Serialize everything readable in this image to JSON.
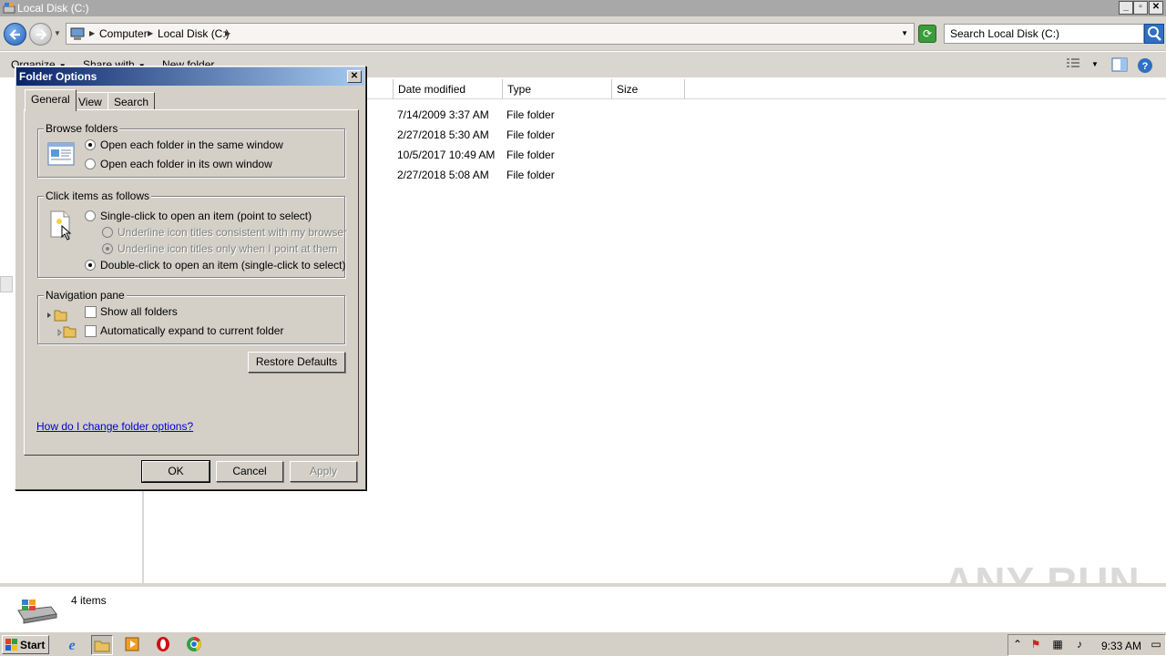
{
  "window": {
    "title": "Local Disk (C:)",
    "buttons": {
      "minimize": "_",
      "maximize": "▫",
      "close": "✕"
    }
  },
  "address": {
    "crumbs": [
      "Computer",
      "Local Disk (C:)"
    ],
    "search_placeholder": "Search Local Disk (C:)"
  },
  "toolbar": {
    "organize": "Organize",
    "share_with": "Share with",
    "new_folder": "New folder"
  },
  "columns": {
    "date_modified": "Date modified",
    "type": "Type",
    "size": "Size"
  },
  "files": [
    {
      "date": "7/14/2009 3:37 AM",
      "type": "File folder"
    },
    {
      "date": "2/27/2018 5:30 AM",
      "type": "File folder"
    },
    {
      "date": "10/5/2017 10:49 AM",
      "type": "File folder"
    },
    {
      "date": "2/27/2018 5:08 AM",
      "type": "File folder"
    }
  ],
  "status": {
    "item_count": "4 items"
  },
  "watermark": "ANY RUN",
  "taskbar": {
    "start": "Start",
    "clock": "9:33 AM"
  },
  "dialog": {
    "title": "Folder Options",
    "close": "✕",
    "tabs": [
      "General",
      "View",
      "Search"
    ],
    "browse_folders": {
      "label": "Browse folders",
      "same_window": "Open each folder in the same window",
      "own_window": "Open each folder in its own window",
      "selected": "same_window"
    },
    "click_items": {
      "label": "Click items as follows",
      "single_click": "Single-click to open an item (point to select)",
      "underline_browser": "Underline icon titles consistent with my browser",
      "underline_point": "Underline icon titles only when I point at them",
      "double_click": "Double-click to open an item (single-click to select)",
      "selected": "double_click"
    },
    "navigation_pane": {
      "label": "Navigation pane",
      "show_all_folders": "Show all folders",
      "auto_expand": "Automatically expand to current folder"
    },
    "restore_defaults": "Restore Defaults",
    "help_link": "How do I change folder options?",
    "ok": "OK",
    "cancel": "Cancel",
    "apply": "Apply"
  }
}
